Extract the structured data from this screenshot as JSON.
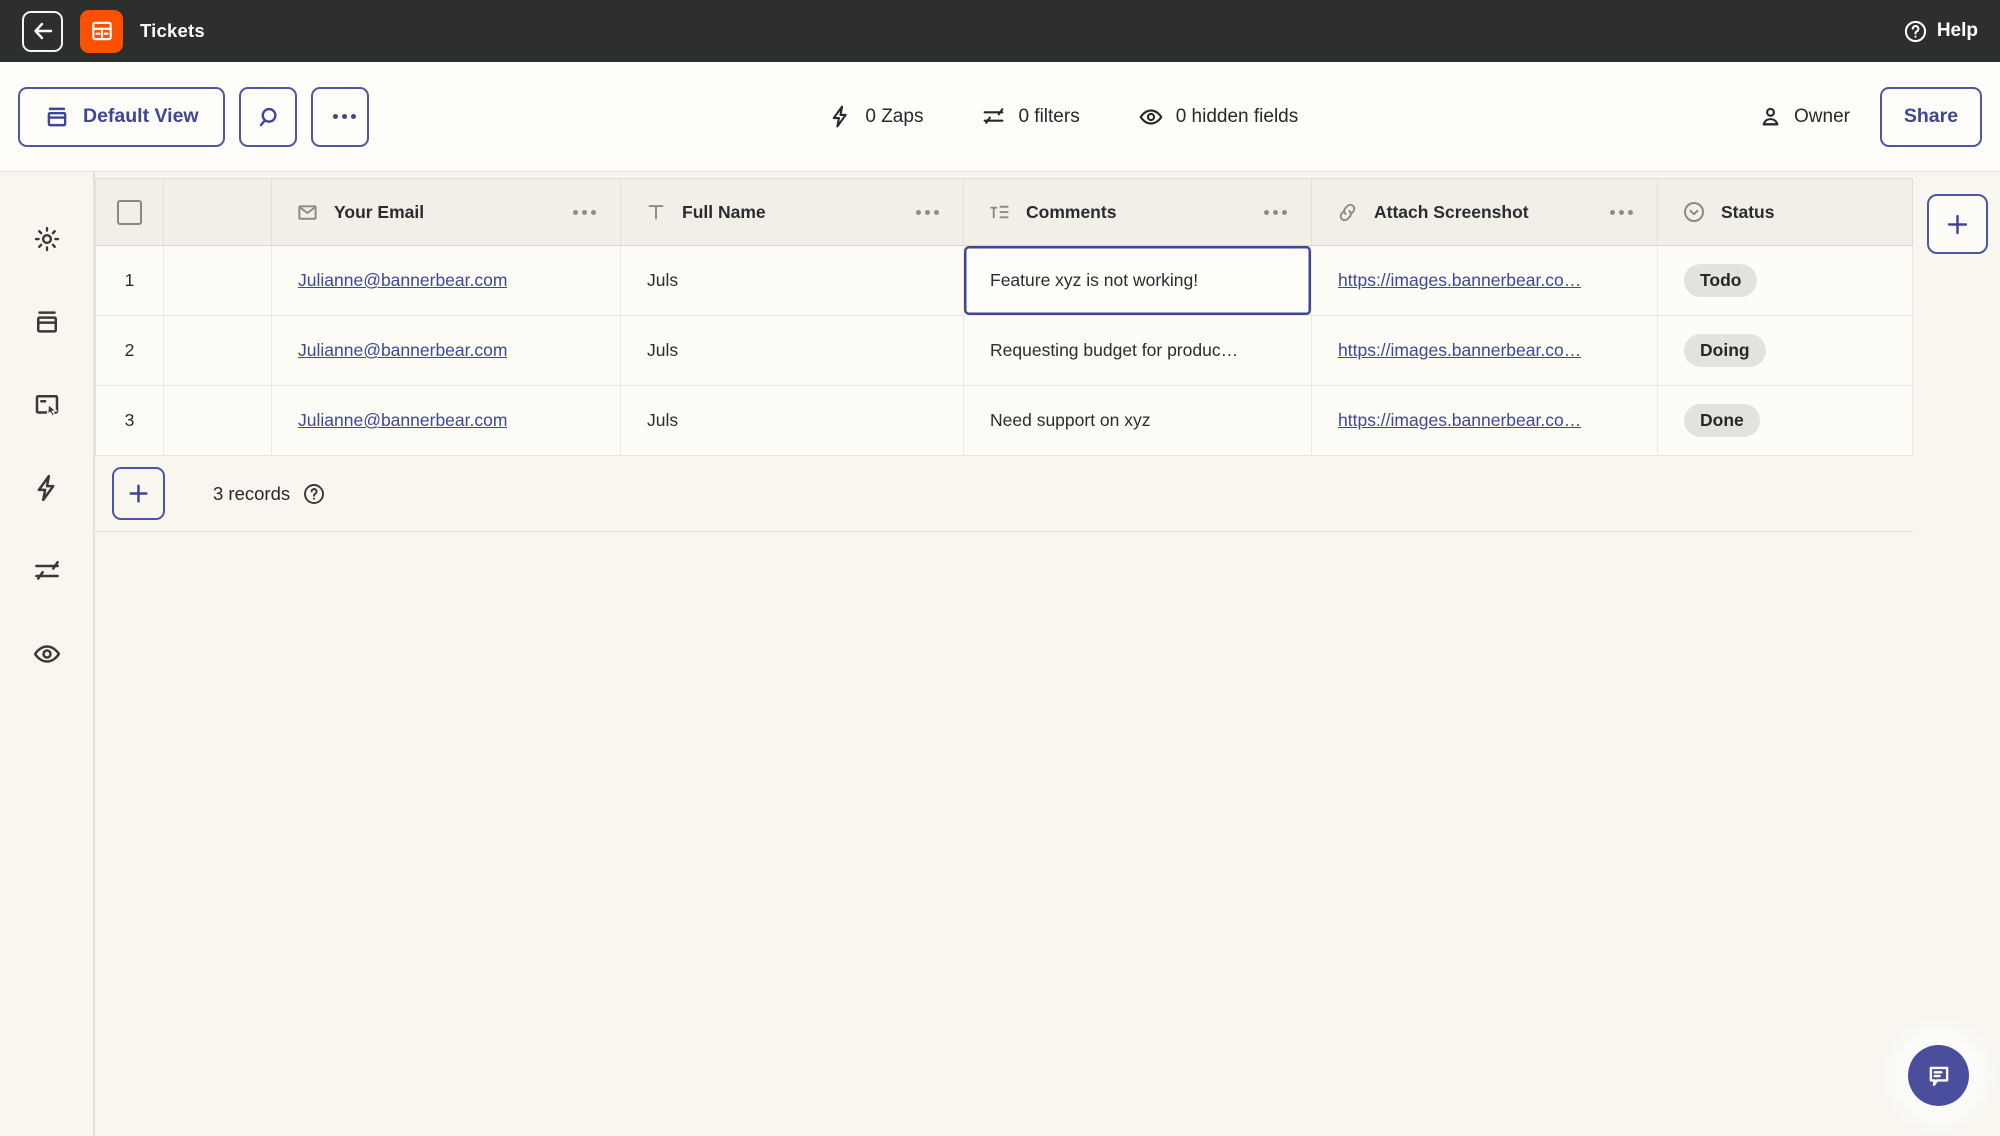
{
  "colors": {
    "accent_indigo": "#3e4795",
    "brand_orange": "#ff4f00",
    "topbar_bg": "#2d2e2e",
    "link": "#3c4899",
    "badge_bg": "#e4e2dc",
    "page_bg": "#f8f6ef"
  },
  "topbar": {
    "title": "Tickets",
    "help_label": "Help"
  },
  "toolbar": {
    "view_label": "Default View",
    "zaps_label": "0 Zaps",
    "filters_label": "0 filters",
    "hidden_fields_label": "0 hidden fields",
    "owner_label": "Owner",
    "share_label": "Share"
  },
  "sidebar": {
    "icons": [
      "settings",
      "views",
      "forms",
      "zaps",
      "filters",
      "hidden-fields"
    ]
  },
  "table": {
    "headers": {
      "email": {
        "label": "Your Email",
        "icon": "envelope"
      },
      "name": {
        "label": "Full Name",
        "icon": "text"
      },
      "comments": {
        "label": "Comments",
        "icon": "long-text"
      },
      "screenshot": {
        "label": "Attach Screenshot",
        "icon": "link"
      },
      "status": {
        "label": "Status",
        "icon": "select-circle"
      }
    },
    "rows": [
      {
        "num": "1",
        "email": "Julianne@bannerbear.com",
        "name": "Juls",
        "comment": "Feature xyz is not working!",
        "url": "https://images.bannerbear.co…",
        "status": "Todo"
      },
      {
        "num": "2",
        "email": "Julianne@bannerbear.com",
        "name": "Juls",
        "comment": "Requesting budget for produc…",
        "url": "https://images.bannerbear.co…",
        "status": "Doing"
      },
      {
        "num": "3",
        "email": "Julianne@bannerbear.com",
        "name": "Juls",
        "comment": "Need support on xyz",
        "url": "https://images.bannerbear.co…",
        "status": "Done"
      }
    ],
    "footer": {
      "records_label": "3 records"
    }
  }
}
